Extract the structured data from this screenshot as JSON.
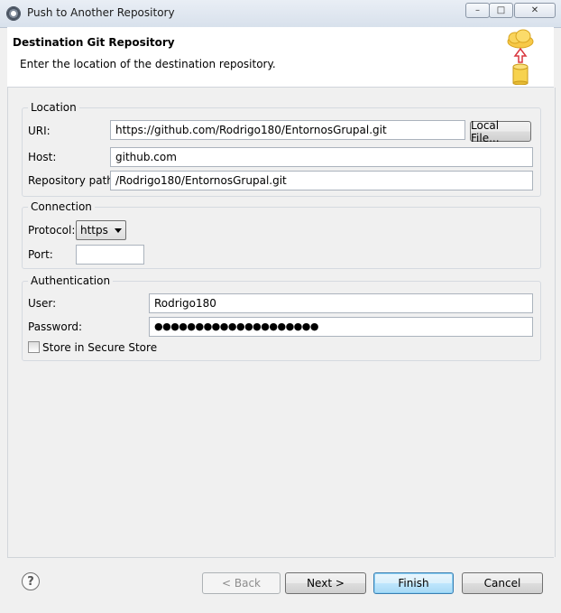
{
  "window": {
    "title": "Push to Another Repository",
    "minimize_glyph": "–",
    "maximize_glyph": "□",
    "close_glyph": "✕"
  },
  "header": {
    "title": "Destination Git Repository",
    "description": "Enter the location of the destination repository.",
    "image_icon": "cloud-push-repository-icon"
  },
  "location": {
    "legend": "Location",
    "uri_label": "URI:",
    "uri_value": "https://github.com/Rodrigo180/EntornosGrupal.git",
    "local_file_button": "Local File...",
    "host_label": "Host:",
    "host_value": "github.com",
    "path_label": "Repository path:",
    "path_value": "/Rodrigo180/EntornosGrupal.git"
  },
  "connection": {
    "legend": "Connection",
    "protocol_label": "Protocol:",
    "protocol_value": "https",
    "port_label": "Port:",
    "port_value": ""
  },
  "authentication": {
    "legend": "Authentication",
    "user_label": "User:",
    "user_value": "Rodrigo180",
    "password_label": "Password:",
    "password_masked": "●●●●●●●●●●●●●●●●●●●●",
    "store_label": "Store in Secure Store",
    "store_checked": false
  },
  "footer": {
    "help_glyph": "?",
    "back_button": "< Back",
    "next_button": "Next >",
    "finish_button": "Finish",
    "cancel_button": "Cancel"
  },
  "colors": {
    "accent_default_button": "#3c7fb1",
    "cloud": "#f7c948",
    "arrow": "#d9363e"
  }
}
